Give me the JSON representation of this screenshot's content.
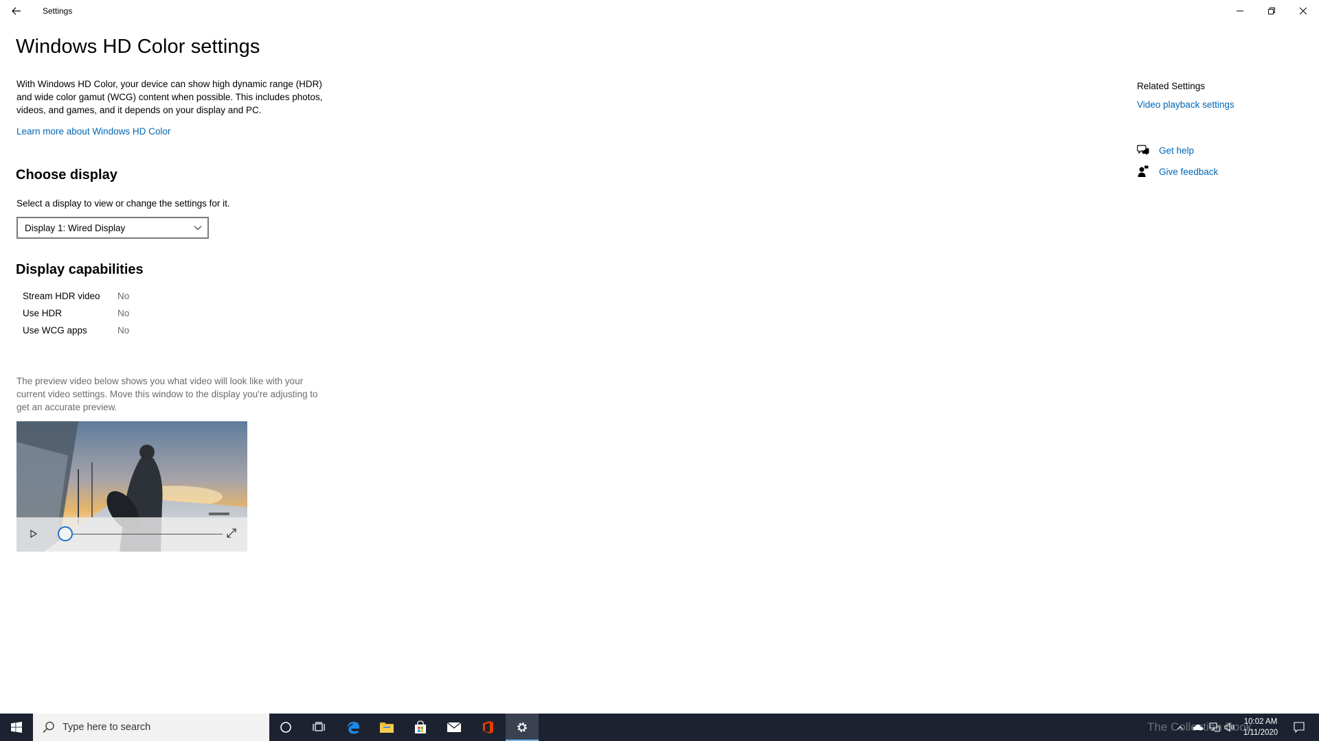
{
  "window": {
    "title": "Settings"
  },
  "page": {
    "title": "Windows HD Color settings",
    "description": "With Windows HD Color, your device can show high dynamic range (HDR) and wide color gamut (WCG) content when possible. This includes photos, videos, and games, and it depends on your display and PC.",
    "learn_more": "Learn more about Windows HD Color"
  },
  "choose_display": {
    "heading": "Choose display",
    "label": "Select a display to view or change the settings for it.",
    "selected": "Display 1: Wired Display"
  },
  "capabilities": {
    "heading": "Display capabilities",
    "rows": [
      {
        "name": "Stream HDR video",
        "value": "No"
      },
      {
        "name": "Use HDR",
        "value": "No"
      },
      {
        "name": "Use WCG apps",
        "value": "No"
      }
    ]
  },
  "preview": {
    "description": "The preview video below shows you what video will look like with your current video settings. Move this window to the display you're adjusting to get an accurate preview.",
    "progress": 0
  },
  "related": {
    "heading": "Related Settings",
    "link": "Video playback settings",
    "get_help": "Get help",
    "give_feedback": "Give feedback"
  },
  "taskbar": {
    "search_placeholder": "Type here to search",
    "time": "10:02 AM",
    "date": "1/11/2020",
    "watermark": "The Collection Book"
  },
  "colors": {
    "link": "#0066b4",
    "taskbar": "#1c2230",
    "accent": "#76b9ed"
  }
}
